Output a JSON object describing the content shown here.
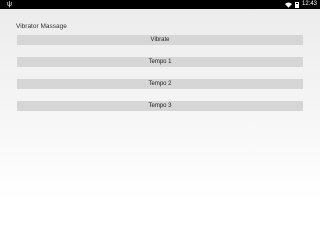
{
  "status_bar": {
    "left_icon": "usb-icon",
    "left_glyph": "ψ",
    "time": "12:43",
    "icons": [
      "wifi-icon",
      "battery-icon"
    ]
  },
  "app": {
    "title": "Vibrator Massage"
  },
  "buttons": {
    "vibrate_label": "Vibrate",
    "tempo1_label": "Tempo 1",
    "tempo2_label": "Tempo 2",
    "tempo3_label": "Tempo 3"
  },
  "colors": {
    "status_bar": "#000000",
    "button": "#d6d6d6",
    "background_top": "#ececec",
    "background_bottom": "#ffffff"
  }
}
